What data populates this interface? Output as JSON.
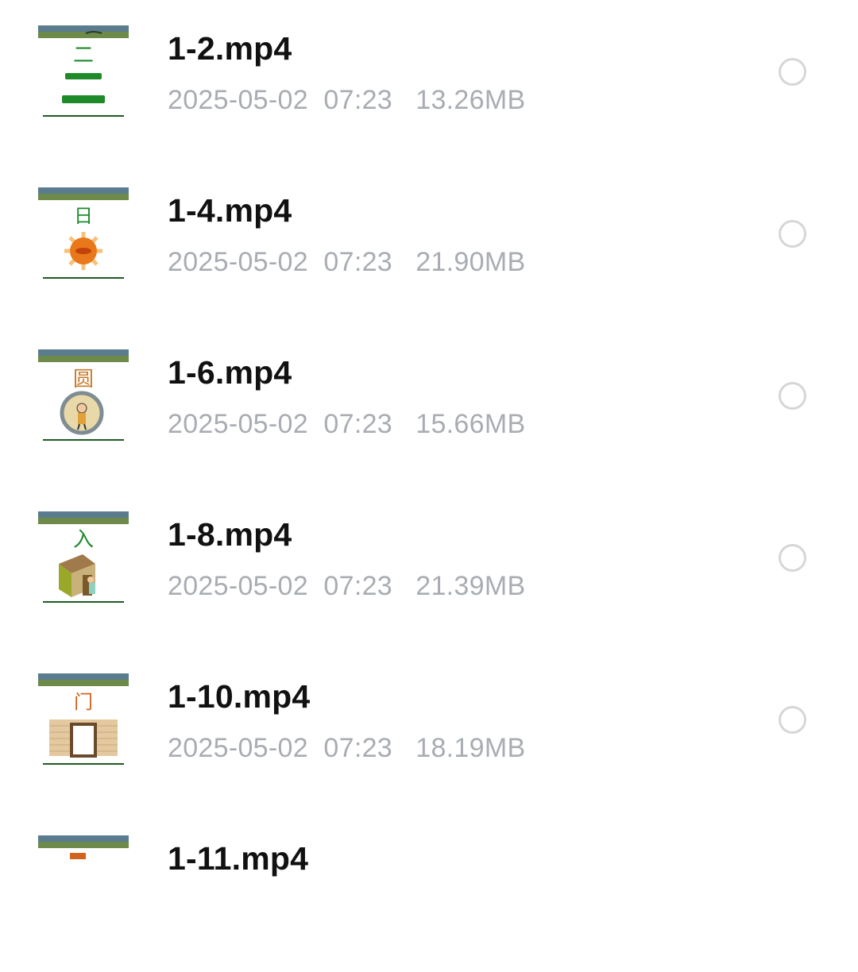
{
  "files": [
    {
      "name": "1-2.mp4",
      "date": "2025-05-02",
      "time": "07:23",
      "size": "13.26MB",
      "thumb": {
        "character": "二",
        "color": "#1e8a2b"
      },
      "icon": "character-two-thumbnail"
    },
    {
      "name": "1-4.mp4",
      "date": "2025-05-02",
      "time": "07:23",
      "size": "21.90MB",
      "thumb": {
        "character": "日",
        "color": "#1e8a2b"
      },
      "icon": "sun-thumbnail"
    },
    {
      "name": "1-6.mp4",
      "date": "2025-05-02",
      "time": "07:23",
      "size": "15.66MB",
      "thumb": {
        "character": "圆",
        "color": "#c77a2a"
      },
      "icon": "circle-boy-thumbnail"
    },
    {
      "name": "1-8.mp4",
      "date": "2025-05-02",
      "time": "07:23",
      "size": "21.39MB",
      "thumb": {
        "character": "入",
        "color": "#1e8a2b"
      },
      "icon": "enter-house-thumbnail"
    },
    {
      "name": "1-10.mp4",
      "date": "2025-05-02",
      "time": "07:23",
      "size": "18.19MB",
      "thumb": {
        "character": "门",
        "color": "#d0641f"
      },
      "icon": "door-thumbnail"
    },
    {
      "name": "1-11.mp4",
      "date": "",
      "time": "",
      "size": "",
      "thumb": {
        "character": "",
        "color": "#d0641f"
      },
      "icon": "video-thumbnail"
    }
  ],
  "colors": {
    "title": "#111111",
    "meta": "#a9adb3",
    "radio_border": "#d6d6d6"
  }
}
